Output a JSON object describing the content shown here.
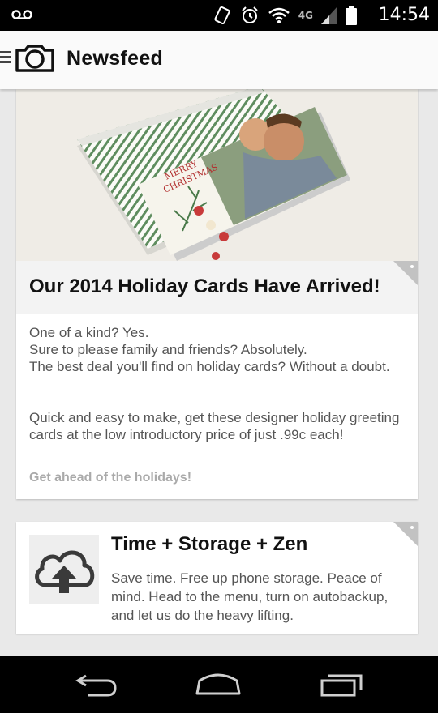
{
  "status_bar": {
    "time": "14:54",
    "network": "4G",
    "icons": [
      "voicemail-icon",
      "vibrate-icon",
      "alarm-icon",
      "wifi-icon",
      "signal-icon",
      "battery-icon"
    ]
  },
  "app_bar": {
    "title": "Newsfeed",
    "icons": [
      "menu-icon",
      "camera-logo-icon"
    ]
  },
  "feed": {
    "cards": [
      {
        "title": "Our 2014 Holiday Cards Have Arrived!",
        "image_text": [
          "MERRY",
          "CHRISTMAS"
        ],
        "paragraphs": [
          "One of a kind? Yes.",
          "Sure to please family and friends? Absolutely.",
          "The best deal you'll find on holiday cards? Without a doubt.",
          "Quick and easy to make, get these designer holiday greeting cards at the low introductory price of just .99c each!"
        ],
        "cta": "Get ahead of the holidays!"
      },
      {
        "title": "Time + Storage + Zen",
        "icon": "cloud-upload-icon",
        "body": "Save time. Free up phone storage. Peace of mind. Head to the menu, turn on autobackup, and let us do the heavy lifting."
      }
    ]
  },
  "nav_bar": {
    "icons": [
      "back-icon",
      "home-icon",
      "recents-icon"
    ]
  },
  "colors": {
    "status_bar": "#000000",
    "app_bar": "#fafafa",
    "background": "#e9e9e9",
    "card": "#ffffff",
    "title_band": "#f3f3f3",
    "muted_text": "#aaaaaa"
  }
}
